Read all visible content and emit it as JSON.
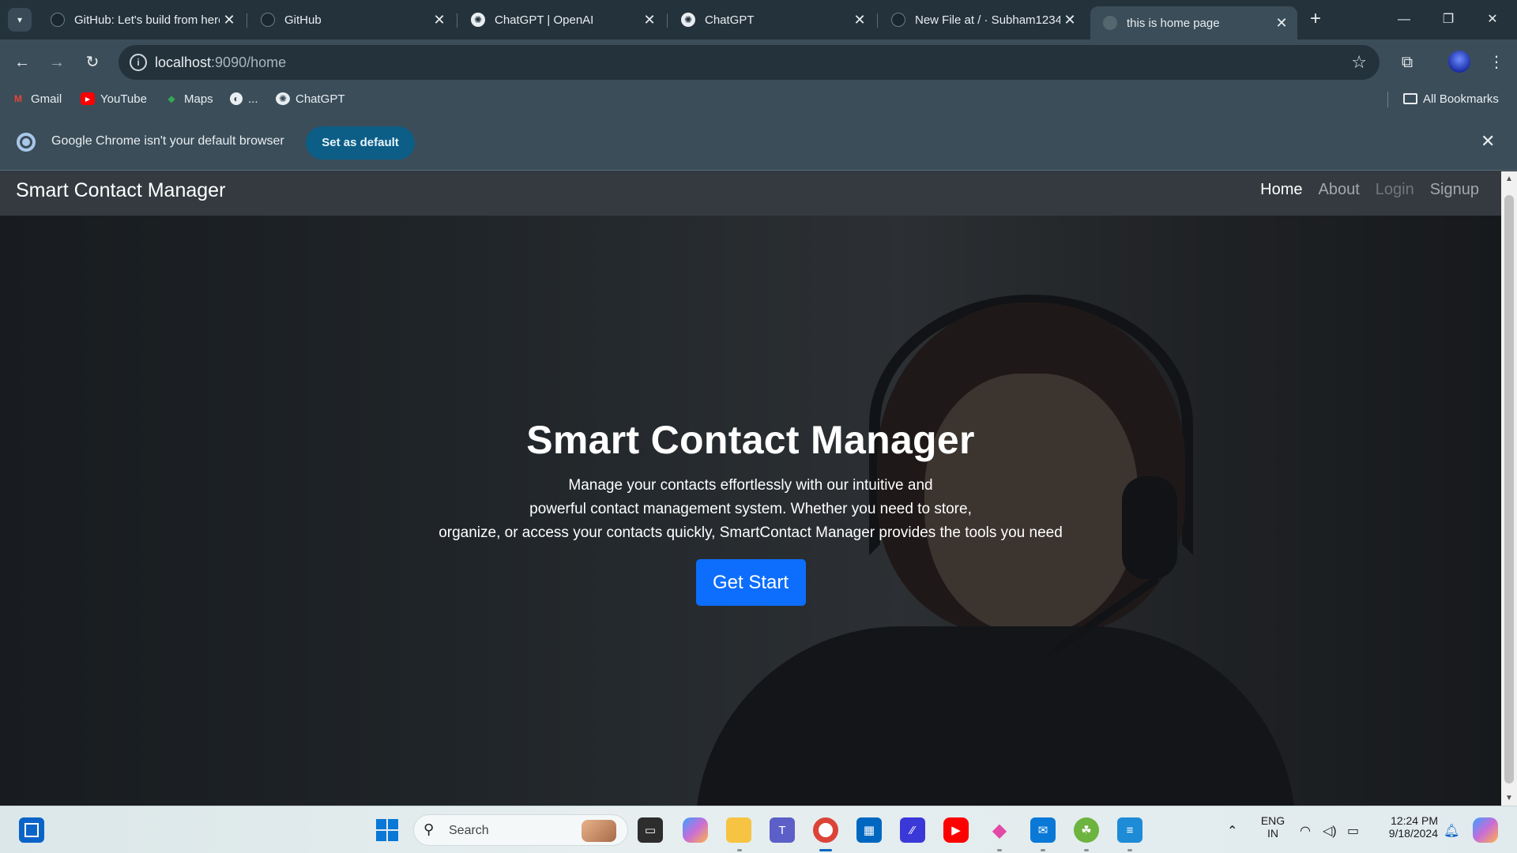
{
  "browser": {
    "tabs": [
      {
        "title": "GitHub: Let's build from here",
        "icon": "github-icon"
      },
      {
        "title": "GitHub",
        "icon": "github-icon"
      },
      {
        "title": "ChatGPT | OpenAI",
        "icon": "openai-icon"
      },
      {
        "title": "ChatGPT",
        "icon": "openai-icon"
      },
      {
        "title": "New File at / · Subham1234",
        "icon": "github-icon"
      },
      {
        "title": "this is home page",
        "icon": "globe-icon",
        "active": true
      }
    ],
    "new_tab_label": "+",
    "window_controls": {
      "minimize": "—",
      "restore": "❐",
      "close": "✕"
    },
    "url_host": "localhost",
    "url_rest": ":9090/home",
    "bookmarks": [
      {
        "label": "Gmail",
        "icon": "gmail-icon"
      },
      {
        "label": "YouTube",
        "icon": "youtube-icon"
      },
      {
        "label": "Maps",
        "icon": "maps-icon"
      },
      {
        "label": "...",
        "icon": "globe-icon"
      },
      {
        "label": "ChatGPT",
        "icon": "openai-icon"
      }
    ],
    "all_bookmarks_label": "All Bookmarks",
    "infobar": {
      "message": "Google Chrome isn't your default browser",
      "button": "Set as default"
    }
  },
  "page": {
    "brand": "Smart Contact Manager",
    "nav": [
      {
        "label": "Home",
        "state": "active"
      },
      {
        "label": "About",
        "state": "normal"
      },
      {
        "label": "Login",
        "state": "disabled"
      },
      {
        "label": "Signup",
        "state": "normal"
      }
    ],
    "hero": {
      "title": "Smart Contact Manager",
      "desc_lines": [
        "Manage your contacts effortlessly with our intuitive and",
        "powerful contact management system. Whether you need to store,",
        "organize, or access your contacts quickly, SmartContact Manager provides the tools you need"
      ],
      "button": "Get Start"
    },
    "colors": {
      "navbar": "#343a40",
      "primary_button": "#0d6efd"
    }
  },
  "taskbar": {
    "search_label": "Search",
    "language": "ENG",
    "region": "IN",
    "time": "12:24 PM",
    "date": "9/18/2024"
  }
}
